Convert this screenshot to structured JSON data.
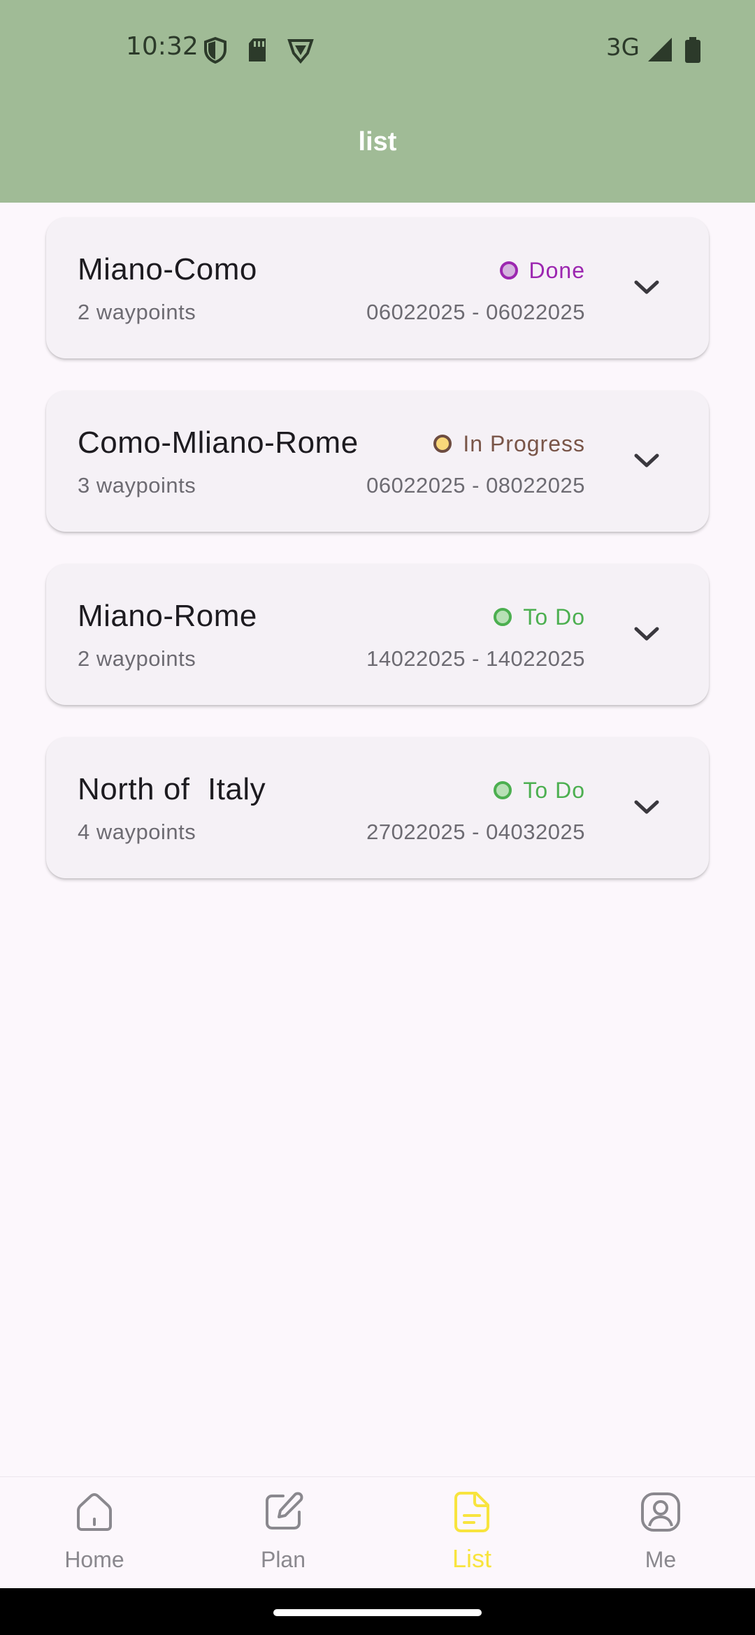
{
  "status_bar": {
    "time": "10:32",
    "network": "3G"
  },
  "app_bar": {
    "title": "list"
  },
  "trips": [
    {
      "name": "Miano-Como",
      "waypoints": "2 waypoints",
      "status": "Done",
      "dates": "06022025 - 06022025",
      "status_color": "#9c27b0",
      "status_fill": "#d4b4de",
      "label_color": "#9c27b0"
    },
    {
      "name": "Como-Mliano-Rome",
      "waypoints": "3 waypoints",
      "status": "In Progress",
      "dates": "06022025 - 08022025",
      "status_color": "#6d4c41",
      "status_fill": "#f9d77a",
      "label_color": "#795548"
    },
    {
      "name": "Miano-Rome",
      "waypoints": "2 waypoints",
      "status": "To Do",
      "dates": "14022025 - 14022025",
      "status_color": "#4caf50",
      "status_fill": "#b8e0b6",
      "label_color": "#4caf50"
    },
    {
      "name": "North of  Italy",
      "waypoints": "4 waypoints",
      "status": "To Do",
      "dates": "27022025 - 04032025",
      "status_color": "#4caf50",
      "status_fill": "#b8e0b6",
      "label_color": "#4caf50"
    }
  ],
  "bottom_nav": {
    "items": [
      {
        "label": "Home",
        "icon": "home-icon",
        "active": false
      },
      {
        "label": "Plan",
        "icon": "edit-icon",
        "active": false
      },
      {
        "label": "List",
        "icon": "document-icon",
        "active": true
      },
      {
        "label": "Me",
        "icon": "user-icon",
        "active": false
      }
    ],
    "active_color": "#f8e43e",
    "inactive_color": "#8a888e"
  }
}
